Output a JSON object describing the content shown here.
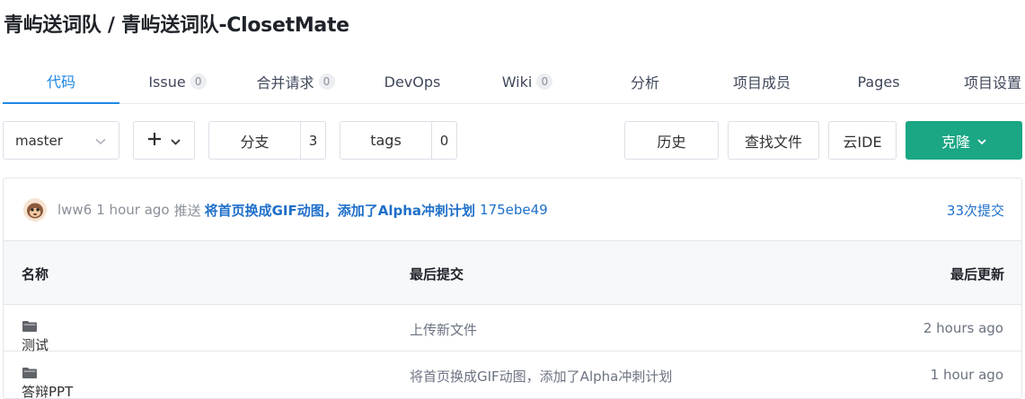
{
  "repo": {
    "path": "青屿送词队 / 青屿送词队-ClosetMate"
  },
  "tabs": [
    {
      "label": "代码",
      "count": null
    },
    {
      "label": "Issue",
      "count": "0"
    },
    {
      "label": "合并请求",
      "count": "0"
    },
    {
      "label": "DevOps",
      "count": null
    },
    {
      "label": "Wiki",
      "count": "0"
    },
    {
      "label": "分析",
      "count": null
    },
    {
      "label": "项目成员",
      "count": null
    },
    {
      "label": "Pages",
      "count": null
    },
    {
      "label": "项目设置",
      "count": null
    }
  ],
  "toolbar": {
    "branch": "master",
    "branches_label": "分支",
    "branches_count": "3",
    "tags_label": "tags",
    "tags_count": "0",
    "history_label": "历史",
    "find_file_label": "查找文件",
    "ide_label": "云IDE",
    "clone_label": "克隆"
  },
  "last_commit": {
    "author": "lww6",
    "time": "1 hour ago",
    "action": "推送",
    "message": "将首页换成GIF动图，添加了Alpha冲刺计划",
    "hash": "175ebe49",
    "commit_count": "33次提交"
  },
  "table": {
    "headers": {
      "name": "名称",
      "last_commit": "最后提交",
      "last_update": "最后更新"
    },
    "rows": [
      {
        "name": "测试",
        "message": "上传新文件",
        "time": "2 hours ago"
      },
      {
        "name": "答辩PPT",
        "message": "将首页换成GIF动图，添加了Alpha冲刺计划",
        "time": "1 hour ago"
      }
    ]
  },
  "colors": {
    "accent": "#1e88e5",
    "clone": "#1ba784",
    "link": "#1e6fc9"
  }
}
